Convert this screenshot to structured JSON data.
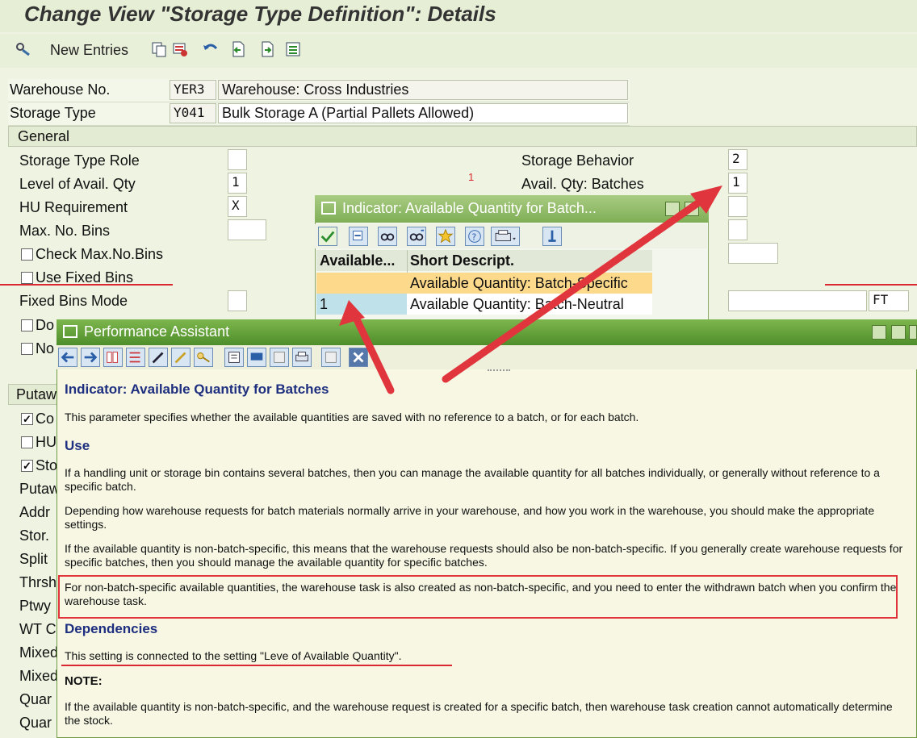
{
  "title": "Change View \"Storage Type Definition\": Details",
  "toolbar": {
    "new_entries": "New Entries"
  },
  "header": {
    "warehouse_label": "Warehouse No.",
    "warehouse_code": "YER3",
    "warehouse_desc": "Warehouse: Cross Industries",
    "storage_type_label": "Storage Type",
    "storage_type_code": "Y041",
    "storage_type_desc": "Bulk Storage A (Partial Pallets Allowed)"
  },
  "general": {
    "section": "General",
    "storage_type_role": "Storage Type Role",
    "level_avail_qty": "Level of Avail. Qty",
    "level_avail_qty_value": "1",
    "hu_requirement": "HU Requirement",
    "hu_requirement_value": "X",
    "max_bins": "Max. No. Bins",
    "check_max_bins": "Check Max.No.Bins",
    "use_fixed_bins": "Use Fixed Bins",
    "fixed_bins_mode": "Fixed Bins Mode",
    "do_partial": "Do",
    "no_partial": "No",
    "storage_behavior": "Storage Behavior",
    "storage_behavior_value": "2",
    "avail_qty_batches": "Avail. Qty: Batches",
    "avail_qty_batches_value": "1",
    "unit_value": "FT",
    "marker": "1"
  },
  "putaway": {
    "section": "Putaw",
    "rows": [
      "Co",
      "HU",
      "Sto",
      "Putaw",
      "Addr",
      "Stor.",
      "Split",
      "Thrsh",
      "Ptwy",
      "WT C",
      "Mixed",
      "Mixed",
      "Quar",
      "Quar"
    ]
  },
  "popup1": {
    "title": "Indicator: Available Quantity for Batch...",
    "col1": "Available...",
    "col2": "Short Descript.",
    "rows": [
      {
        "key": "",
        "desc": "Available Quantity: Batch-Specific"
      },
      {
        "key": "1",
        "desc": "Available Quantity: Batch-Neutral"
      }
    ]
  },
  "popup2": {
    "title": "Performance Assistant",
    "heading": "Indicator: Available Quantity for Batches",
    "intro": "This parameter specifies whether the available quantities are saved with no reference to a batch, or for each batch.",
    "use_heading": "Use",
    "use_p1": "If a handling unit or storage bin contains several batches, then you can manage the available quantity for all batches individually, or generally without reference to a specific batch.",
    "use_p2": "Depending how warehouse requests for batch materials normally arrive in your warehouse, and how you work in the warehouse, you should make the appropriate settings.",
    "use_p3": "If the available quantity is non-batch-specific, this means that the warehouse requests should also be non-batch-specific. If you generally create warehouse requests for specific batches, then you should manage the available quantity for specific batches.",
    "use_p4": "For non-batch-specific available quantities, the warehouse task is also created as non-batch-specific, and you need to enter the withdrawn batch when you confirm the warehouse task.",
    "dep_heading": "Dependencies",
    "dep_p1": "This setting is connected to the setting \"Leve of Available Quantity\".",
    "note_heading": "NOTE:",
    "note_p1": "If the available quantity is non-batch-specific, and the warehouse request is created for a specific batch, then warehouse task creation cannot automatically determine the stock."
  },
  "colors": {
    "accent_green": "#5a9a32",
    "annotation_red": "#e0353c",
    "highlight_orange": "#fcd98b"
  }
}
